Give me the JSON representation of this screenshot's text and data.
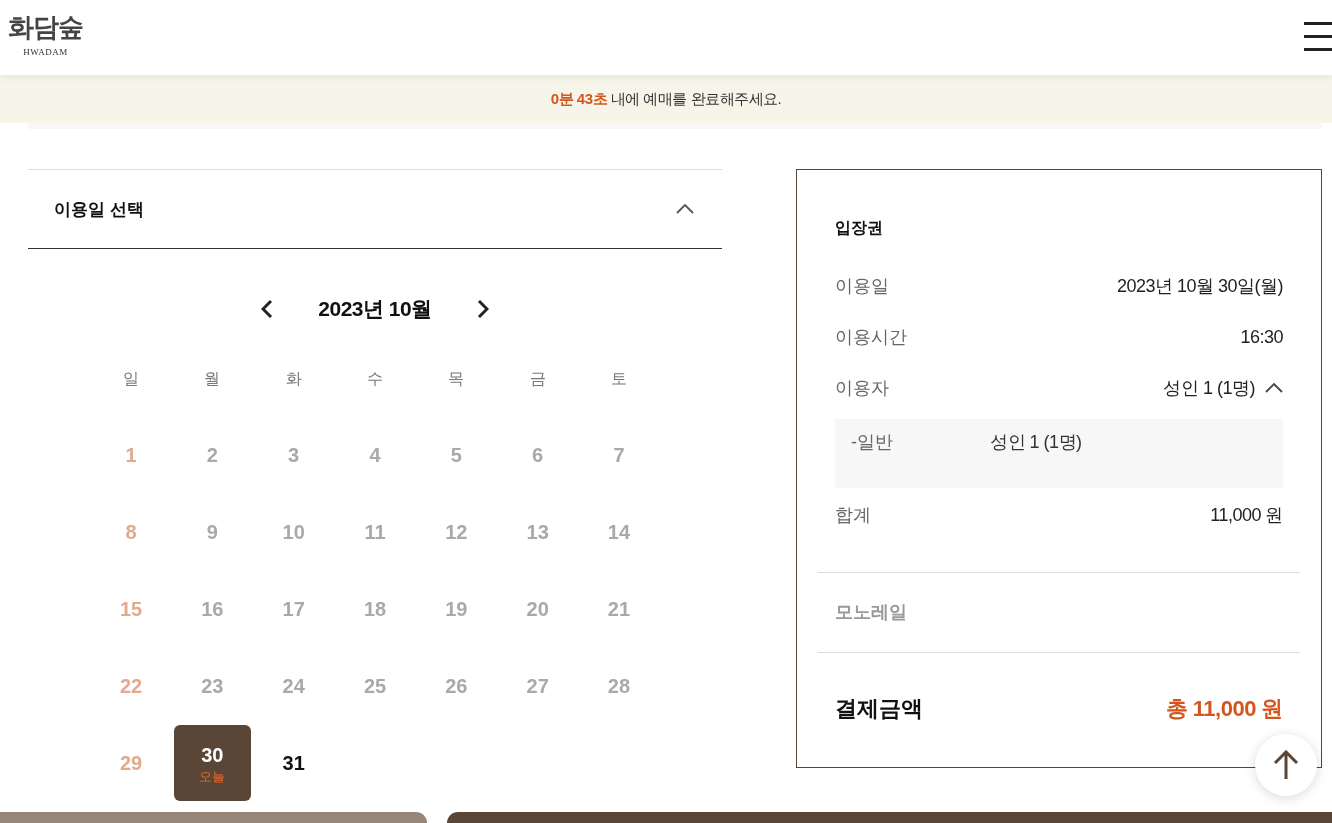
{
  "header": {
    "logo": {
      "title": "화담숲",
      "subtitle": "HWADAM"
    }
  },
  "banner": {
    "message": "**0분 43초** 내에 예매를 완료해주세요."
  },
  "date_section": {
    "title": "이용일 선택",
    "expanded": true
  },
  "calendar": {
    "month": "2023년 10월",
    "weekdays": [
      "일",
      "월",
      "화",
      "수",
      "목",
      "금",
      "토"
    ],
    "weeks": [
      [
        {
          "label": "1",
          "disabled": true,
          "selected": false
        },
        {
          "label": "2",
          "disabled": true,
          "selected": false
        },
        {
          "label": "3",
          "disabled": true,
          "selected": false
        },
        {
          "label": "4",
          "disabled": true,
          "selected": false
        },
        {
          "label": "5",
          "disabled": true,
          "selected": false
        },
        {
          "label": "6",
          "disabled": true,
          "selected": false
        },
        {
          "label": "7",
          "disabled": true,
          "selected": false
        }
      ],
      [
        {
          "label": "8",
          "disabled": true,
          "selected": false
        },
        {
          "label": "9",
          "disabled": true,
          "selected": false
        },
        {
          "label": "10",
          "disabled": true,
          "selected": false
        },
        {
          "label": "11",
          "disabled": true,
          "selected": false
        },
        {
          "label": "12",
          "disabled": true,
          "selected": false
        },
        {
          "label": "13",
          "disabled": true,
          "selected": false
        },
        {
          "label": "14",
          "disabled": true,
          "selected": false
        }
      ],
      [
        {
          "label": "15",
          "disabled": true,
          "selected": false
        },
        {
          "label": "16",
          "disabled": true,
          "selected": false
        },
        {
          "label": "17",
          "disabled": true,
          "selected": false
        },
        {
          "label": "18",
          "disabled": true,
          "selected": false
        },
        {
          "label": "19",
          "disabled": true,
          "selected": false
        },
        {
          "label": "20",
          "disabled": true,
          "selected": false
        },
        {
          "label": "21",
          "disabled": true,
          "selected": false
        }
      ],
      [
        {
          "label": "22",
          "disabled": true,
          "selected": false
        },
        {
          "label": "23",
          "disabled": true,
          "selected": false
        },
        {
          "label": "24",
          "disabled": true,
          "selected": false
        },
        {
          "label": "25",
          "disabled": true,
          "selected": false
        },
        {
          "label": "26",
          "disabled": true,
          "selected": false
        },
        {
          "label": "27",
          "disabled": true,
          "selected": false
        },
        {
          "label": "28",
          "disabled": true,
          "selected": false
        }
      ],
      [
        {
          "label": "29",
          "disabled": true,
          "selected": false
        },
        {
          "label": "30",
          "disabled": false,
          "selected": true,
          "note": "오늘"
        },
        {
          "label": "31",
          "disabled": false,
          "selected": false
        }
      ]
    ]
  },
  "summary": {
    "ticket": {
      "title": "입장권",
      "date": {
        "label": "이용일",
        "value": "2023년 10월 30일(월)"
      },
      "time": {
        "label": "이용시간",
        "value": "16:30"
      },
      "users": {
        "label": "이용자",
        "value": "성인 1 (1명)",
        "expanded": true,
        "details": [
          {
            "label": "-일반",
            "value": "성인 1 (1명)"
          }
        ]
      },
      "subtotal": {
        "label": "합계",
        "value": "11,000 원"
      }
    },
    "monorail": {
      "title": "모노레일",
      "disabled": true
    },
    "total": {
      "label": "결제금액",
      "value": "총 11,000 원"
    }
  }
}
